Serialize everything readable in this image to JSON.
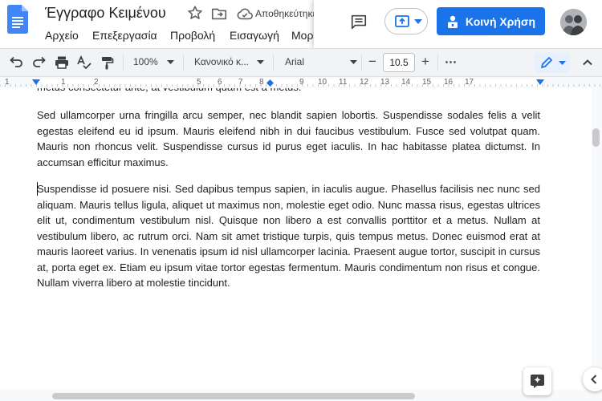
{
  "header": {
    "title": "Έγγραφο Κειμένου",
    "save_status": "Αποθηκεύτηκε",
    "menu": [
      "Αρχείο",
      "Επεξεργασία",
      "Προβολή",
      "Εισαγωγή",
      "Μορφή"
    ],
    "share_label": "Κοινή Χρήση"
  },
  "toolbar": {
    "zoom": "100%",
    "style": "Κανονικό κ...",
    "font": "Arial",
    "font_size": "10.5",
    "minus": "−",
    "plus": "+",
    "more": "⋯"
  },
  "ruler": {
    "left_numbers": [
      "1",
      "1",
      "2"
    ],
    "numbers": [
      "5",
      "6",
      "7",
      "8",
      "9",
      "10",
      "11",
      "12",
      "13",
      "14",
      "15",
      "16",
      "17"
    ]
  },
  "document": {
    "partial_line": "metus consectetur ante, at vestibulum quam est a metus.",
    "paragraph1": "Sed ullamcorper urna fringilla arcu semper, nec blandit sapien lobortis. Suspendisse sodales felis a velit egestas eleifend eu id ipsum. Mauris eleifend nibh in dui faucibus vestibulum. Fusce sed volutpat quam. Mauris non rhoncus velit. Suspendisse cursus id purus eget iaculis. In hac habitasse platea dictumst. In accumsan efficitur maximus.",
    "paragraph2": "Suspendisse id posuere nisi. Sed dapibus tempus sapien, in iaculis augue. Phasellus facilisis nec nunc sed aliquam. Mauris tellus ligula, aliquet ut maximus non, molestie eget odio. Nunc massa risus, egestas ultrices elit ut, condimentum vestibulum nisl. Quisque non libero a est convallis porttitor et a metus. Nullam at vestibulum libero, ac rutrum orci. Nam sit amet tristique turpis, quis tempus metus. Donec euismod erat at mauris laoreet varius. In venenatis ipsum id nisl ullamcorper lacinia. Praesent augue tortor, suscipit in cursus at, porta eget ex. Etiam eu ipsum vitae tortor egestas fermentum. Mauris condimentum non risus et congue. Nullam viverra libero at molestie tincidunt."
  },
  "colors": {
    "accent": "#1a73e8",
    "doc_icon": "#4285f4",
    "toolbar_bg": "#f1f3f4"
  },
  "icons": [
    "docs-logo-icon",
    "star-icon",
    "move-folder-icon",
    "cloud-saved-icon",
    "comment-icon",
    "present-icon",
    "lock-person-icon",
    "undo-icon",
    "redo-icon",
    "print-icon",
    "spellcheck-icon",
    "paint-format-icon",
    "pencil-icon",
    "chevron-up-icon",
    "explore-icon",
    "chevron-left-icon"
  ]
}
